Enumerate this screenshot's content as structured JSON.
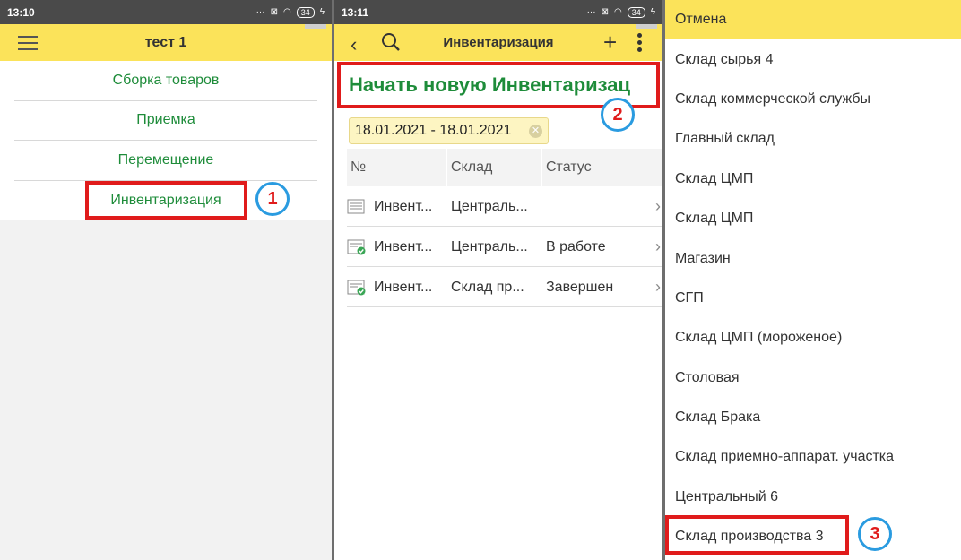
{
  "panel1": {
    "status": {
      "time": "13:10",
      "battery": "34"
    },
    "title": "тест 1",
    "menu": [
      "Сборка товаров",
      "Приемка",
      "Перемещение",
      "Инвентаризация"
    ],
    "badge": "1"
  },
  "panel2": {
    "status": {
      "time": "13:11",
      "battery": "34"
    },
    "title": "Инвентаризация",
    "start_button": "Начать новую Инвентаризац",
    "badge": "2",
    "period": "18.01.2021 - 18.01.2021",
    "columns": [
      "№",
      "Склад",
      "Статус"
    ],
    "rows": [
      {
        "num": "Инвент...",
        "warehouse": "Централь...",
        "status": ""
      },
      {
        "num": "Инвент...",
        "warehouse": "Централь...",
        "status": "В работе"
      },
      {
        "num": "Инвент...",
        "warehouse": "Склад пр...",
        "status": "Завершен"
      }
    ]
  },
  "panel3": {
    "items": [
      "Отмена",
      "Склад сырья 4",
      "Склад коммерческой службы",
      "Главный склад",
      "Склад ЦМП",
      "Склад ЦМП",
      "Магазин",
      "СГП",
      "Склад ЦМП (мороженое)",
      "Столовая",
      "Склад Брака",
      "Склад приемно-аппарат. участка",
      "Центральный 6",
      "Склад производства 3"
    ],
    "badge": "3"
  },
  "colors": {
    "appbar": "#fbe35a",
    "accent_green": "#1e8c3a",
    "highlight_red": "#e01b1b",
    "badge_blue": "#2a9be0"
  }
}
